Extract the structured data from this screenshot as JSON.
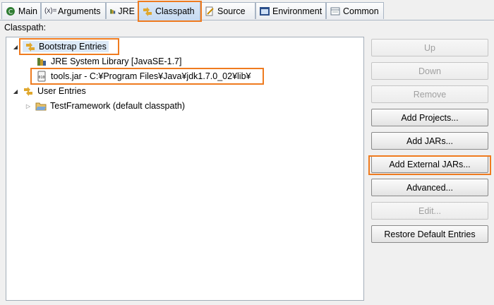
{
  "tabs": [
    {
      "label": "Main"
    },
    {
      "label": "Arguments"
    },
    {
      "label": "JRE"
    },
    {
      "label": "Classpath"
    },
    {
      "label": "Source"
    },
    {
      "label": "Environment"
    },
    {
      "label": "Common"
    }
  ],
  "section_label": "Classpath:",
  "tree": {
    "bootstrap": "Bootstrap Entries",
    "jre_lib": "JRE System Library [JavaSE-1.7]",
    "tools_jar": "tools.jar - C:¥Program Files¥Java¥jdk1.7.0_02¥lib¥",
    "user": "User Entries",
    "testframework": "TestFramework (default classpath)"
  },
  "buttons": {
    "up": "Up",
    "down": "Down",
    "remove": "Remove",
    "add_projects": "Add Projects...",
    "add_jars": "Add JARs...",
    "add_external_jars": "Add External JARs...",
    "advanced": "Advanced...",
    "edit": "Edit...",
    "restore": "Restore Default Entries"
  },
  "colors": {
    "highlight": "#ef7b1f",
    "selection": "#dce9f7"
  }
}
